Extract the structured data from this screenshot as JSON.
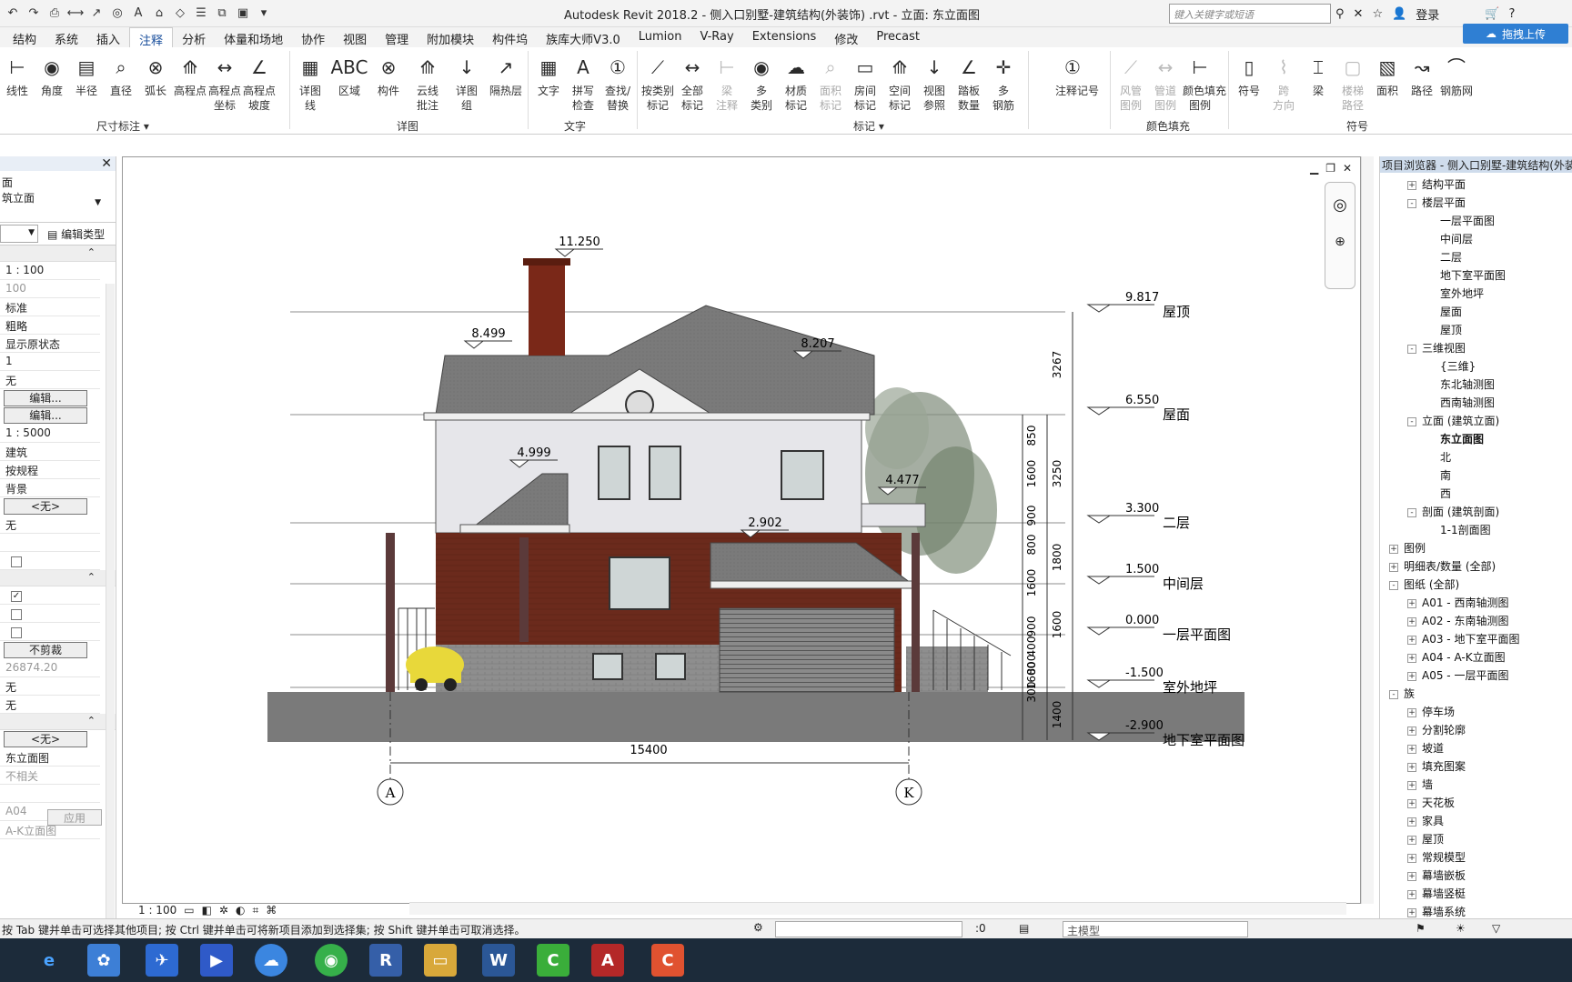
{
  "app": {
    "title": "Autodesk Revit 2018.2 -    侧入口别墅-建筑结构(外装饰) .rvt - 立面: 东立面图",
    "search_placeholder": "键入关键字或短语",
    "login": "登录",
    "upload": "拖拽上传"
  },
  "tabs": [
    "结构",
    "系统",
    "插入",
    "注释",
    "分析",
    "体量和场地",
    "协作",
    "视图",
    "管理",
    "附加模块",
    "构件坞",
    "族库大师V3.0",
    "Lumion",
    "V-Ray",
    "Extensions",
    "修改",
    "Precast"
  ],
  "ribbon": {
    "dim": [
      "线性",
      "角度",
      "半径",
      "直径",
      "弧长",
      "高程点",
      "高程点\n坐标",
      "高程点\n坡度"
    ],
    "dim_label": "尺寸标注 ▾",
    "detail": [
      "详图\n线",
      "区域",
      "构件",
      "云线\n批注",
      "详图\n组",
      "隔热层"
    ],
    "detail_label": "详图",
    "text": [
      "文字",
      "拼写\n检查",
      "查找/\n替换"
    ],
    "text_label": "文字",
    "tag": [
      "按类别\n标记",
      "全部\n标记",
      "梁\n注释",
      "多\n类别",
      "材质\n标记",
      "面积\n标记",
      "房间\n标记",
      "空间\n标记",
      "视图\n参照",
      "踏板\n数量",
      "多\n钢筋"
    ],
    "tag_label": "标记 ▾",
    "keynote": "注释记号",
    "color": [
      "风管\n图例",
      "管道\n图例",
      "颜色填充\n图例"
    ],
    "color_label": "颜色填充",
    "symbol": [
      "符号",
      "跨\n方向",
      "梁",
      "面积",
      "路径",
      "钢筋网"
    ],
    "symbol_label": "符号",
    "extra_label": "楼梯\n路径"
  },
  "properties": {
    "type_top": "面",
    "type_sub": "筑立面",
    "edit_type": "编辑类型",
    "rows1": [
      "1 : 100",
      "100",
      "标准",
      "粗略",
      "显示原状态",
      "1",
      "无"
    ],
    "edit1": "编辑...",
    "edit2": "编辑...",
    "rows2": [
      "1 : 5000",
      "建筑",
      "按规程",
      "背景"
    ],
    "none1": "<无>",
    "row_none": "无",
    "crop": "不剪裁",
    "crop_val": "26874.20",
    "rows3": [
      "无",
      "无"
    ],
    "none2": "<无>",
    "view_name": "东立面图",
    "not_rel": "不相关",
    "sheet_num": "A04",
    "sheet_name": "A-K立面图",
    "apply": "应用"
  },
  "drawing": {
    "levels": [
      {
        "value": "9.817",
        "name": "屋顶"
      },
      {
        "value": "6.550",
        "name": "屋面"
      },
      {
        "value": "3.300",
        "name": "二层"
      },
      {
        "value": "1.500",
        "name": "中间层"
      },
      {
        "value": "0.000",
        "name": "一层平面图"
      },
      {
        "value": "-1.500",
        "name": "室外地坪"
      },
      {
        "value": "-2.900",
        "name": "地下室平面图"
      }
    ],
    "spot": [
      "11.250",
      "8.499",
      "8.207",
      "4.999",
      "4.477",
      "2.902"
    ],
    "dims_outer": [
      "3267",
      "3250",
      "1800",
      "1600",
      "1400"
    ],
    "dims_inner": [
      "850",
      "1600",
      "900",
      "800",
      "1600",
      "900",
      "400",
      "800",
      "1600",
      "300"
    ],
    "width": "15400",
    "grid_left": "A",
    "grid_right": "K"
  },
  "view_status": {
    "scale": "1 : 100"
  },
  "browser": {
    "title": "项目浏览器 - 侧入口别墅-建筑结构(外装",
    "items": [
      {
        "t": "结构平面",
        "lv": 1,
        "tg": "+"
      },
      {
        "t": "楼层平面",
        "lv": 1,
        "tg": "-"
      },
      {
        "t": "一层平面图",
        "lv": 2
      },
      {
        "t": "中间层",
        "lv": 2
      },
      {
        "t": "二层",
        "lv": 2
      },
      {
        "t": "地下室平面图",
        "lv": 2
      },
      {
        "t": "室外地坪",
        "lv": 2
      },
      {
        "t": "屋面",
        "lv": 2
      },
      {
        "t": "屋顶",
        "lv": 2
      },
      {
        "t": "三维视图",
        "lv": 1,
        "tg": "-"
      },
      {
        "t": "{三维}",
        "lv": 2
      },
      {
        "t": "东北轴测图",
        "lv": 2
      },
      {
        "t": "西南轴测图",
        "lv": 2
      },
      {
        "t": "立面 (建筑立面)",
        "lv": 1,
        "tg": "-"
      },
      {
        "t": "东立面图",
        "lv": 2,
        "bold": true
      },
      {
        "t": "北",
        "lv": 2
      },
      {
        "t": "南",
        "lv": 2
      },
      {
        "t": "西",
        "lv": 2
      },
      {
        "t": "剖面 (建筑剖面)",
        "lv": 1,
        "tg": "-"
      },
      {
        "t": "1-1剖面图",
        "lv": 2
      },
      {
        "t": "图例",
        "lv": 0,
        "tg": "+"
      },
      {
        "t": "明细表/数量 (全部)",
        "lv": 0,
        "tg": "+"
      },
      {
        "t": "图纸 (全部)",
        "lv": 0,
        "tg": "-"
      },
      {
        "t": "A01 - 西南轴测图",
        "lv": 1,
        "tg": "+"
      },
      {
        "t": "A02 - 东南轴测图",
        "lv": 1,
        "tg": "+"
      },
      {
        "t": "A03 - 地下室平面图",
        "lv": 1,
        "tg": "+"
      },
      {
        "t": "A04 - A-K立面图",
        "lv": 1,
        "tg": "+"
      },
      {
        "t": "A05 - 一层平面图",
        "lv": 1,
        "tg": "+"
      },
      {
        "t": "族",
        "lv": 0,
        "tg": "-"
      },
      {
        "t": "停车场",
        "lv": 1,
        "tg": "+"
      },
      {
        "t": "分割轮廓",
        "lv": 1,
        "tg": "+"
      },
      {
        "t": "坡道",
        "lv": 1,
        "tg": "+"
      },
      {
        "t": "填充图案",
        "lv": 1,
        "tg": "+"
      },
      {
        "t": "墙",
        "lv": 1,
        "tg": "+"
      },
      {
        "t": "天花板",
        "lv": 1,
        "tg": "+"
      },
      {
        "t": "家具",
        "lv": 1,
        "tg": "+"
      },
      {
        "t": "屋顶",
        "lv": 1,
        "tg": "+"
      },
      {
        "t": "常规模型",
        "lv": 1,
        "tg": "+"
      },
      {
        "t": "幕墙嵌板",
        "lv": 1,
        "tg": "+"
      },
      {
        "t": "幕墙竖梃",
        "lv": 1,
        "tg": "+"
      },
      {
        "t": "幕墙系统",
        "lv": 1,
        "tg": "+"
      }
    ]
  },
  "statusbar": {
    "hint": "按 Tab 键并单击可选择其他项目; 按 Ctrl 键并单击可将新项目添加到选择集; 按 Shift 键并单击可取消选择。",
    "zero": ":0",
    "model": "主模型"
  }
}
